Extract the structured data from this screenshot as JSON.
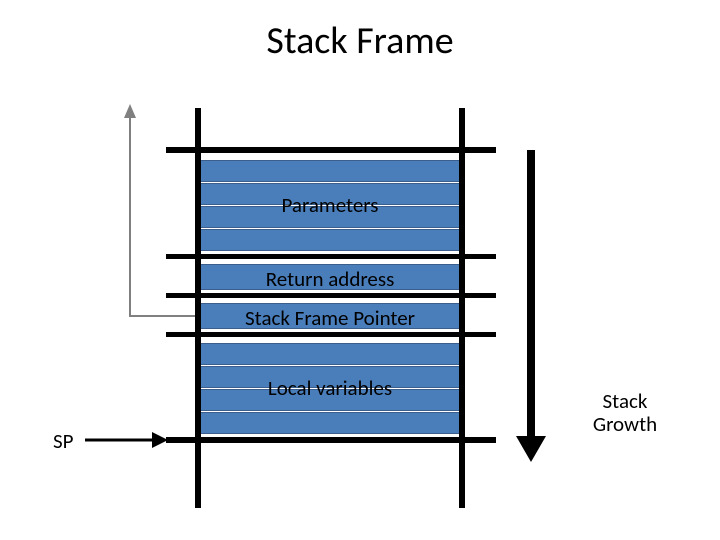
{
  "title": "Stack Frame",
  "sections": {
    "parameters": "Parameters",
    "return_address": "Return address",
    "stack_frame_pointer": "Stack Frame Pointer",
    "local_variables": "Local variables"
  },
  "sp_label": "SP",
  "growth_label": "Stack\nGrowth",
  "colors": {
    "slot_fill": "#4a7ebb",
    "slot_border": "#3b5e8c"
  }
}
